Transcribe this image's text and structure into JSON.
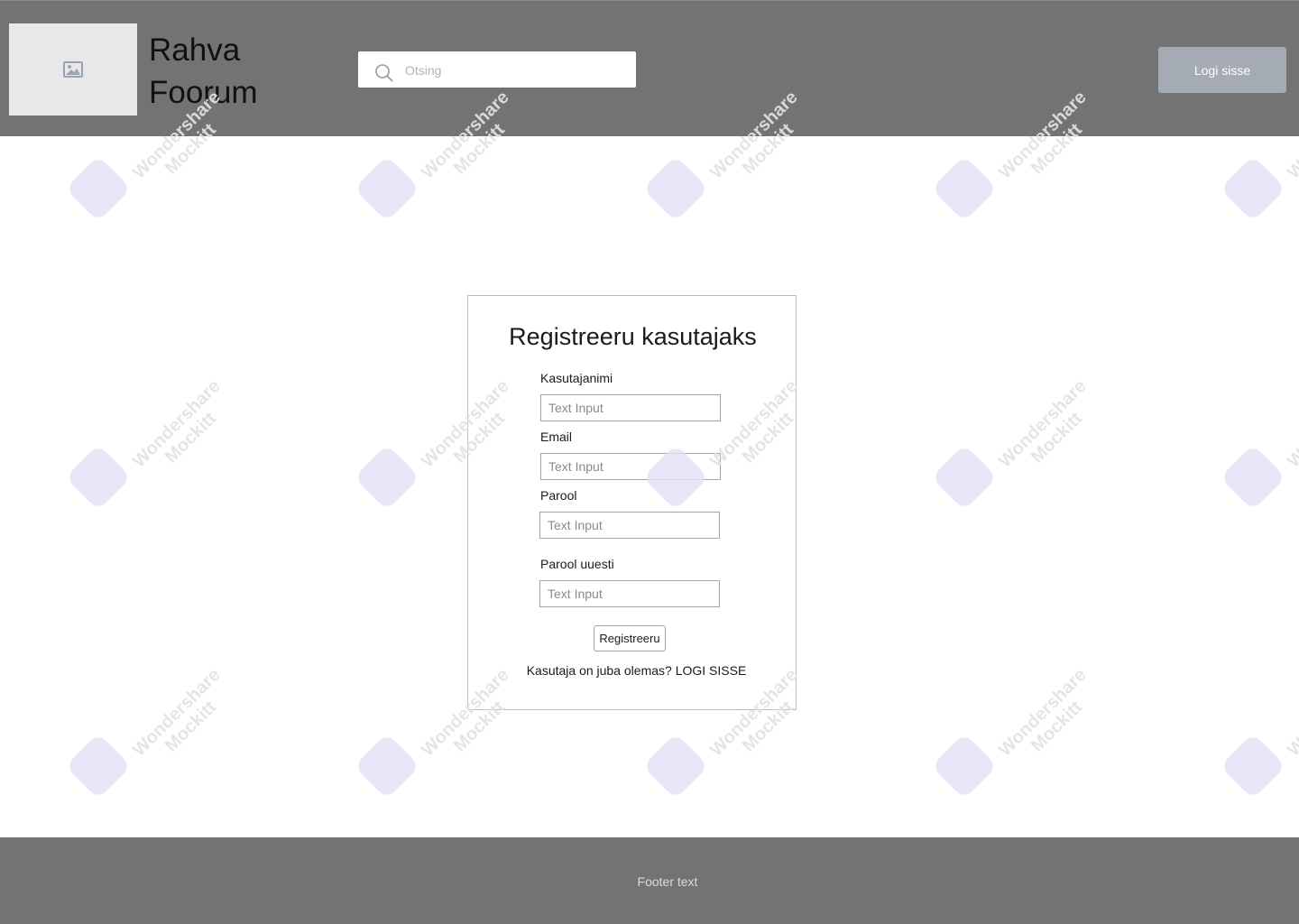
{
  "header": {
    "site_title_line1": "Rahva",
    "site_title_line2": "Foorum",
    "logo_icon": "image-placeholder-icon",
    "search": {
      "placeholder": "Otsing",
      "icon": "search-icon"
    },
    "login_button": "Logi sisse"
  },
  "form": {
    "title": "Registreeru kasutajaks",
    "fields": [
      {
        "label": "Kasutajanimi",
        "placeholder": "Text Input"
      },
      {
        "label": "Email",
        "placeholder": "Text Input"
      },
      {
        "label": "Parool",
        "placeholder": "Text Input"
      },
      {
        "label": "Parool uuesti",
        "placeholder": "Text Input"
      }
    ],
    "submit_button": "Registreeru",
    "login_hint": "Kasutaja on juba olemas?",
    "login_link": "LOGI SISSE"
  },
  "footer": {
    "text": "Footer text"
  },
  "watermark": {
    "line1": "Wondershare",
    "line2": "Mockitt"
  },
  "colors": {
    "header_bg": "#737373",
    "footer_bg": "#737373",
    "login_button_bg": "#a5abb3",
    "page_bg": "#ffffff"
  }
}
